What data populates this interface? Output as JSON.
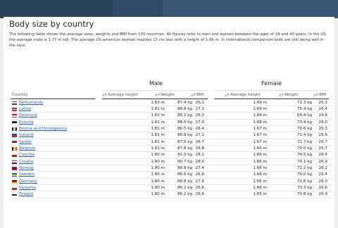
{
  "page": {
    "title": "Body size by country",
    "intro": "The following table shows the average sizes, weights and BMI from 130 countries. All figures refer to men and women between the ages of 18 and 40 years. In the US, the average male is 1.77 m tall. The average US-american woman reaches 13 cm less with a height of 1.66 m. In international comparison both are still doing well in the race."
  },
  "table": {
    "group_male": "Male",
    "group_female": "Female",
    "headers": {
      "country": "Country",
      "avg_height": "Average height",
      "weight": "Weight",
      "bmi": "BMI"
    },
    "rows": [
      {
        "country": "Netherlands",
        "flag": [
          "#ae1c28",
          "#ffffff",
          "#21468b"
        ],
        "flag_dir": "h",
        "m_h": "1.83 m",
        "m_w": "87.4 kg",
        "m_b": "26.1",
        "f_h": "1.69 m",
        "f_w": "72.3 kg",
        "f_b": "25.3"
      },
      {
        "country": "Latvia",
        "flag": [
          "#9e3039",
          "#ffffff",
          "#9e3039"
        ],
        "flag_dir": "h",
        "m_h": "1.81 m",
        "m_w": "88.8 kg",
        "m_b": "27.1",
        "f_h": "1.69 m",
        "f_w": "75.4 kg",
        "f_b": "26.4"
      },
      {
        "country": "Denmark",
        "flag": [
          "#c8102e",
          "#ffffff",
          "#c8102e"
        ],
        "flag_dir": "h",
        "m_h": "1.81 m",
        "m_w": "86.2 kg",
        "m_b": "26.3",
        "f_h": "1.68 m",
        "f_w": "69.4 kg",
        "f_b": "24.6"
      },
      {
        "country": "Estonia",
        "flag": [
          "#0072ce",
          "#000000",
          "#ffffff"
        ],
        "flag_dir": "h",
        "m_h": "1.81 m",
        "m_w": "88.5 kg",
        "m_b": "27.0",
        "f_h": "1.68 m",
        "f_w": "73.4 kg",
        "f_b": "26.0"
      },
      {
        "country": "Bosnia and Herzegovina",
        "flag": [
          "#002395",
          "#fecb00",
          "#002395"
        ],
        "flag_dir": "v",
        "m_h": "1.81 m",
        "m_w": "86.5 kg",
        "m_b": "26.4",
        "f_h": "1.67 m",
        "f_w": "70.6 kg",
        "f_b": "25.3"
      },
      {
        "country": "Iceland",
        "flag": [
          "#02529c",
          "#dc1e35",
          "#02529c"
        ],
        "flag_dir": "h",
        "m_h": "1.81 m",
        "m_w": "88.8 kg",
        "m_b": "27.1",
        "f_h": "1.67 m",
        "f_w": "71.4 kg",
        "f_b": "25.6"
      },
      {
        "country": "Serbia",
        "flag": [
          "#c6363c",
          "#0c4076",
          "#ffffff"
        ],
        "flag_dir": "h",
        "m_h": "1.81 m",
        "m_w": "87.5 kg",
        "m_b": "26.7",
        "f_h": "1.67 m",
        "f_w": "71.7 kg",
        "f_b": "25.7"
      },
      {
        "country": "Belgium",
        "flag": [
          "#000000",
          "#fdda24",
          "#ef3340"
        ],
        "flag_dir": "v",
        "m_h": "1.81 m",
        "m_w": "87.8 kg",
        "m_b": "26.8",
        "f_h": "1.65 m",
        "f_w": "70.0 kg",
        "f_b": "25.7"
      },
      {
        "country": "Czechia",
        "flag": [
          "#ffffff",
          "#d7141a",
          "#11457e"
        ],
        "flag_dir": "h",
        "m_h": "1.80 m",
        "m_w": "91.0 kg",
        "m_b": "28.1",
        "f_h": "1.68 m",
        "f_w": "74.5 kg",
        "f_b": "26.4"
      },
      {
        "country": "Croatia",
        "flag": [
          "#ff0000",
          "#ffffff",
          "#171796"
        ],
        "flag_dir": "h",
        "m_h": "1.80 m",
        "m_w": "90.7 kg",
        "m_b": "28.0",
        "f_h": "1.66 m",
        "f_w": "74.1 kg",
        "f_b": "26.9"
      },
      {
        "country": "Norway",
        "flag": [
          "#ba0c2f",
          "#00205b",
          "#ba0c2f"
        ],
        "flag_dir": "h",
        "m_h": "1.80 m",
        "m_w": "88.8 kg",
        "m_b": "27.4",
        "f_h": "1.66 m",
        "f_w": "72.2 kg",
        "f_b": "26.2"
      },
      {
        "country": "Sweden",
        "flag": [
          "#006aa7",
          "#fecc00",
          "#006aa7"
        ],
        "flag_dir": "h",
        "m_h": "1.80 m",
        "m_w": "86.8 kg",
        "m_b": "26.8",
        "f_h": "1.66 m",
        "f_w": "70.0 kg",
        "f_b": "25.4"
      },
      {
        "country": "Germany",
        "flag": [
          "#000000",
          "#dd0000",
          "#ffce00"
        ],
        "flag_dir": "h",
        "m_h": "1.80 m",
        "m_w": "88.8 kg",
        "m_b": "27.4",
        "f_h": "1.66 m",
        "f_w": "71.6 kg",
        "f_b": "26.0"
      },
      {
        "country": "Slovenia",
        "flag": [
          "#ffffff",
          "#005da4",
          "#ed1c24"
        ],
        "flag_dir": "h",
        "m_h": "1.80 m",
        "m_w": "86.2 kg",
        "m_b": "26.6",
        "f_h": "1.66 m",
        "f_w": "73.3 kg",
        "f_b": "26.6"
      },
      {
        "country": "Finland",
        "flag": [
          "#ffffff",
          "#002f6c",
          "#ffffff"
        ],
        "flag_dir": "h",
        "m_h": "1.80 m",
        "m_w": "86.2 kg",
        "m_b": "26.6",
        "f_h": "1.65 m",
        "f_w": "70.8 kg",
        "f_b": "25.9"
      }
    ]
  }
}
